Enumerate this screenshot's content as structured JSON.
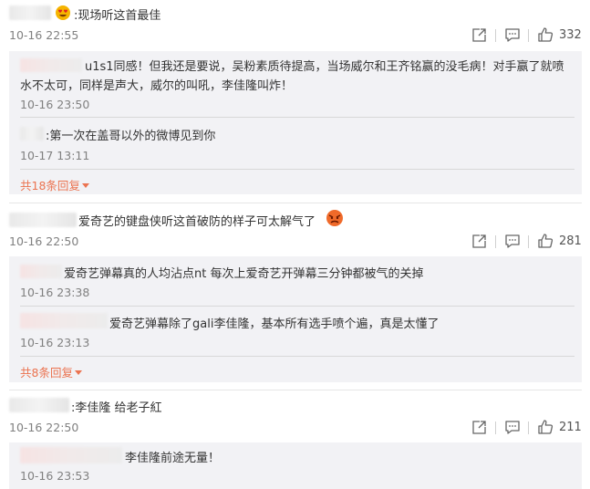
{
  "comments": [
    {
      "text": ":现场听这首最佳",
      "time": "10-16 22:55",
      "likes": "332",
      "replies": [
        {
          "line1": "u1s1同感！但我还是要说，吴粉素质待提高，当场威尔和王齐铭赢的没毛病！对手赢了就喷",
          "line2": "水不太可，同样是声大，威尔的叫吼，李佳隆叫炸！",
          "time": "10-16 23:50"
        },
        {
          "text": ":第一次在盖哥以外的微博见到你",
          "time": "10-17 13:11"
        }
      ],
      "more": "共18条回复"
    },
    {
      "text": "爱奇艺的键盘侠听这首破防的样子可太解气了",
      "time": "10-16 22:50",
      "likes": "281",
      "replies": [
        {
          "text": "爱奇艺弹幕真的人均沾点nt 每次上爱奇艺开弹幕三分钟都被气的关掉",
          "time": "10-16 23:38"
        },
        {
          "text": "爱奇艺弹幕除了gali李佳隆，基本所有选手喷个遍，真是太懂了",
          "time": "10-16 23:13"
        }
      ],
      "more": "共8条回复"
    },
    {
      "text": ":李佳隆 给老子紅",
      "time": "10-16 22:50",
      "likes": "211",
      "replies": [
        {
          "text": "李佳隆前途无量！",
          "time": "10-16 23:53"
        }
      ]
    }
  ],
  "icons": {
    "emoji1": "heart-eyes-emoji-icon",
    "emoji2": "angry-face-emoji-icon",
    "share": "share-icon",
    "comment": "comment-icon",
    "like": "thumbs-up-icon"
  },
  "colors": {
    "accent": "#eb7350",
    "time": "#808080",
    "reply_bg": "#f2f2f5"
  }
}
